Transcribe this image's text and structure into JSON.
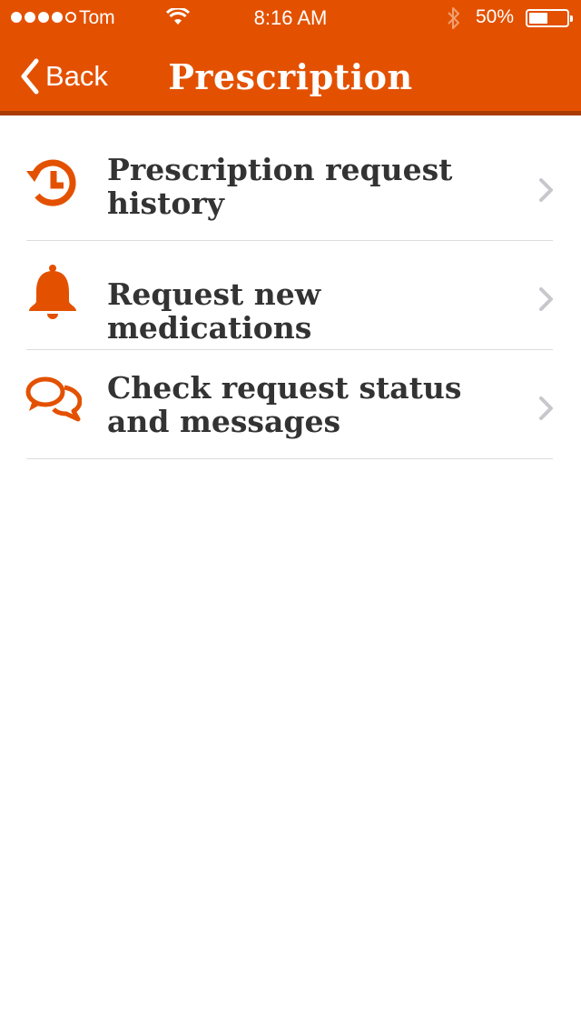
{
  "status_bar": {
    "carrier": "Tom",
    "time": "8:16 AM",
    "battery_percent": "50%",
    "signal_bars_filled": 4,
    "signal_bars_total": 5,
    "battery_level": 0.5,
    "icons": [
      "signal-dots-icon",
      "wifi-icon",
      "bluetooth-icon",
      "battery-icon"
    ]
  },
  "nav": {
    "back_label": "Back",
    "title": "Prescription",
    "back_icon": "chevron-left-icon"
  },
  "menu": {
    "items": [
      {
        "label": "Prescription request history",
        "icon": "history-icon"
      },
      {
        "label": "Request new medications",
        "icon": "bell-icon"
      },
      {
        "label": "Check request status and messages",
        "icon": "chat-bubbles-icon"
      }
    ],
    "chevron_icon": "chevron-right-icon"
  },
  "colors": {
    "brand_orange": "#E35100",
    "nav_border": "#A83B00",
    "text_dark": "#333333",
    "divider": "#DCDCDC",
    "chevron": "#C7C7CC",
    "background": "#FFFFFF"
  }
}
